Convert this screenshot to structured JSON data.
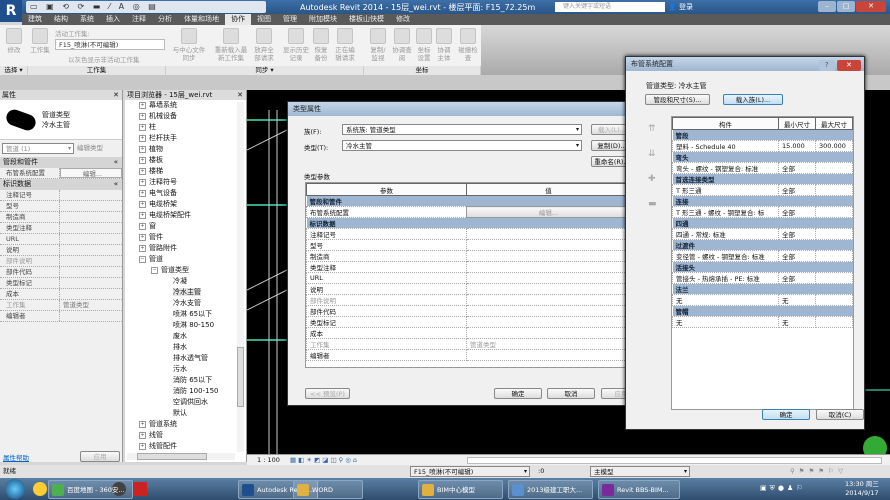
{
  "titlebar": {
    "title": "Autodesk Revit 2014 -   15层_wei.rvt - 楼层平面: F15_72.25m",
    "search_placeholder": "键入关键字或短语",
    "login": "登录",
    "minimize": "–",
    "maximize": "□",
    "close": "✕",
    "app_letter": "R"
  },
  "ribbon": {
    "tabs": [
      "建筑",
      "结构",
      "系统",
      "插入",
      "注释",
      "分析",
      "体量和场地",
      "协作",
      "视图",
      "管理",
      "附加模块",
      "楼板山快模",
      "修改"
    ],
    "active_tab": "协作",
    "buttons": {
      "modify": "修改",
      "worksets": "工作集",
      "active_workset_label": "活动工作集:",
      "active_workset": "F15_喷淋(不可编辑)",
      "gray_inactive": "以灰色显示非活动工作集",
      "sync": "与中心文件同步",
      "reload": "重新载入最新工作集",
      "relinquish": "放弃全部请求",
      "history": "显示历史记录",
      "restore": "恢复备份",
      "editing_req": "正在编辑请求",
      "copy_monitor": "复制/监视",
      "coord_review": "协调查阅",
      "coord_settings": "坐标设置",
      "coord_body": "协调主体",
      "interference": "碰撞检查"
    },
    "panels": {
      "select": "选择 ▾",
      "worksets": "工作集",
      "sync": "同步 ▾",
      "coordinate": "坐标"
    }
  },
  "properties": {
    "title": "属性",
    "type_family": "管道类型",
    "type_name": "冷水主管",
    "selector": "管道 (1)",
    "edit_type": "编辑类型",
    "groups": [
      {
        "name": "管段和管件",
        "rows": [
          {
            "label": "布管系统配置",
            "value": "编辑..."
          }
        ]
      },
      {
        "name": "标识数据",
        "rows": [
          {
            "label": "注释记号",
            "value": ""
          },
          {
            "label": "型号",
            "value": ""
          },
          {
            "label": "制造商",
            "value": ""
          },
          {
            "label": "类型注释",
            "value": ""
          },
          {
            "label": "URL",
            "value": ""
          },
          {
            "label": "说明",
            "value": ""
          },
          {
            "label": "部件说明",
            "value": ""
          },
          {
            "label": "部件代码",
            "value": ""
          },
          {
            "label": "类型标记",
            "value": ""
          },
          {
            "label": "成本",
            "value": ""
          },
          {
            "label": "工作集",
            "value": "管道类型"
          },
          {
            "label": "编辑者",
            "value": ""
          }
        ]
      }
    ],
    "help_link": "属性帮助",
    "apply": "应用"
  },
  "browser": {
    "title": "项目浏览器 - 15层_wei.rvt",
    "top_items": [
      "幕墙系统",
      "机械设备",
      "柱",
      "栏杆扶手",
      "植物",
      "楼板",
      "楼梯",
      "注释符号",
      "电气设备",
      "电缆桥架",
      "电缆桥架配件",
      "窗",
      "管件",
      "管路附件",
      "管道"
    ],
    "pipe_types_label": "管道类型",
    "pipe_types": [
      "冷凝",
      "冷水主管",
      "冷水支管",
      "喷淋 65以下",
      "喷淋 80-150",
      "废水",
      "排水",
      "排水透气管",
      "污水",
      "消防 65以下",
      "消防 100-150",
      "空调供回水",
      "默认"
    ],
    "selected": "冷水主管",
    "bottom_items": [
      "管道系统",
      "线管",
      "线管配件"
    ]
  },
  "type_dialog": {
    "title": "类型属性",
    "family_label": "族(F):",
    "family_value": "系统族: 管道类型",
    "type_label": "类型(T):",
    "type_value": "冷水主管",
    "load": "载入(L)...",
    "duplicate": "复制(D)...",
    "rename": "重命名(R)...",
    "params_label": "类型参数",
    "col_param": "参数",
    "col_value": "值",
    "groups": [
      {
        "name": "管段和管件",
        "rows": [
          {
            "label": "布管系统配置",
            "value": "编辑..."
          }
        ]
      },
      {
        "name": "标识数据",
        "rows": [
          {
            "label": "注释记号",
            "value": ""
          },
          {
            "label": "型号",
            "value": ""
          },
          {
            "label": "制造商",
            "value": ""
          },
          {
            "label": "类型注释",
            "value": ""
          },
          {
            "label": "URL",
            "value": ""
          },
          {
            "label": "说明",
            "value": ""
          },
          {
            "label": "部件说明",
            "value": ""
          },
          {
            "label": "部件代码",
            "value": ""
          },
          {
            "label": "类型标记",
            "value": ""
          },
          {
            "label": "成本",
            "value": ""
          },
          {
            "label": "工作集",
            "value": "管道类型"
          },
          {
            "label": "编辑者",
            "value": ""
          }
        ]
      }
    ],
    "preview": "<< 预览(P)",
    "ok": "确定",
    "cancel": "取消",
    "apply": "应用"
  },
  "routing_dialog": {
    "title": "布管系统配置",
    "help": "?",
    "close": "✕",
    "pipe_type_label": "管道类型:",
    "pipe_type_value": "冷水主管",
    "segments_btn": "管段和尺寸(S)...",
    "load_family_btn": "载入族(L)...",
    "side_icons": [
      "move-up-icon",
      "move-down-icon",
      "add-icon",
      "remove-icon"
    ],
    "columns": [
      "构件",
      "最小尺寸",
      "最大尺寸"
    ],
    "groups": [
      {
        "name": "管段",
        "row": [
          "塑料 - Schedule 40",
          "15.000",
          "300.000"
        ]
      },
      {
        "name": "弯头",
        "row": [
          "弯头 - 螺纹 - 钢塑复合: 标准",
          "全部",
          ""
        ]
      },
      {
        "name": "首选连接类型",
        "row": [
          "T 形三通",
          "全部",
          ""
        ]
      },
      {
        "name": "连接",
        "row": [
          "T 形三通 - 螺纹 - 钢塑复合: 标",
          "全部",
          ""
        ]
      },
      {
        "name": "四通",
        "row": [
          "四通 - 常规: 标准",
          "全部",
          ""
        ]
      },
      {
        "name": "过渡件",
        "row": [
          "变径管 - 螺纹 - 钢塑复合: 标准",
          "全部",
          ""
        ]
      },
      {
        "name": "活接头",
        "row": [
          "管接头 - 热熔承插 - PE: 标准",
          "全部",
          ""
        ]
      },
      {
        "name": "法兰",
        "row": [
          "无",
          "无",
          ""
        ]
      },
      {
        "name": "管帽",
        "row": [
          "无",
          "无",
          ""
        ]
      }
    ],
    "ok": "确定",
    "cancel": "取消(C)"
  },
  "viewbar": {
    "scale": "1 : 100"
  },
  "status": {
    "text": "就绪",
    "workset": "F15_喷淋(不可编辑)",
    "count": ":0",
    "model": "主模型"
  },
  "taskbar": {
    "items": [
      {
        "label": "百度地图 - 360安...",
        "color": "#4caf50"
      },
      {
        "label": "Autodesk Revit ...",
        "color": "#1f4e8c"
      },
      {
        "label": "WORD",
        "color": "#e0b040"
      },
      {
        "label": "BIM中心模型",
        "color": "#e0b040"
      },
      {
        "label": "2013级建工职大...",
        "color": "#5a8fd0"
      },
      {
        "label": "Revit BBS-BIM...",
        "color": "#7a2a9a"
      }
    ],
    "time": "13:30 周三",
    "date": "2014/9/17"
  }
}
